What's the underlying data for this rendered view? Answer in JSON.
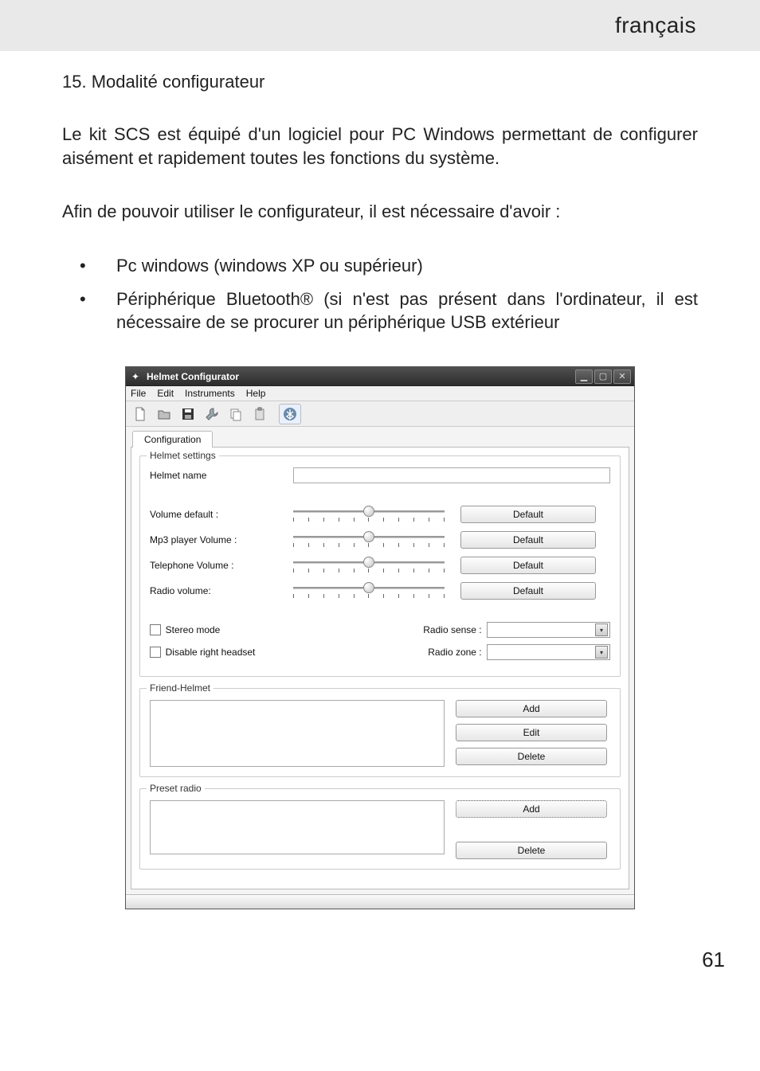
{
  "header": {
    "language": "français"
  },
  "doc": {
    "section_title": "15. Modalité configurateur",
    "para1": "Le kit SCS est équipé d'un logiciel pour PC Windows permettant de configurer aisément et rapidement toutes les fonctions du système.",
    "para2": "Afin de pouvoir utiliser le configurateur, il est nécessaire d'avoir :",
    "bullet1": "Pc windows (windows XP ou supérieur)",
    "bullet2": "Périphérique Bluetooth® (si n'est pas présent dans l'ordinateur, il est nécessaire de se procurer un périphérique USB extérieur",
    "page_number": "61"
  },
  "app": {
    "title": "Helmet Configurator",
    "menus": {
      "file": "File",
      "edit": "Edit",
      "instruments": "Instruments",
      "help": "Help"
    },
    "toolbar_icons": [
      "new-file-icon",
      "open-folder-icon",
      "save-icon",
      "tool-icon",
      "copy-icon",
      "paste-icon",
      "bluetooth-icon"
    ],
    "tab": "Configuration",
    "helmet_settings": {
      "legend": "Helmet settings",
      "name_label": "Helmet name",
      "name_value": "",
      "sliders": [
        {
          "label": "Volume default :",
          "btn": "Default"
        },
        {
          "label": "Mp3 player Volume :",
          "btn": "Default"
        },
        {
          "label": "Telephone Volume :",
          "btn": "Default"
        },
        {
          "label": "Radio volume:",
          "btn": "Default"
        }
      ],
      "stereo_label": "Stereo mode",
      "disable_label": "Disable right headset",
      "radio_sense_label": "Radio sense :",
      "radio_zone_label": "Radio zone :"
    },
    "friend": {
      "legend": "Friend-Helmet",
      "add": "Add",
      "edit": "Edit",
      "delete": "Delete"
    },
    "preset": {
      "legend": "Preset radio",
      "add": "Add",
      "delete": "Delete"
    }
  }
}
